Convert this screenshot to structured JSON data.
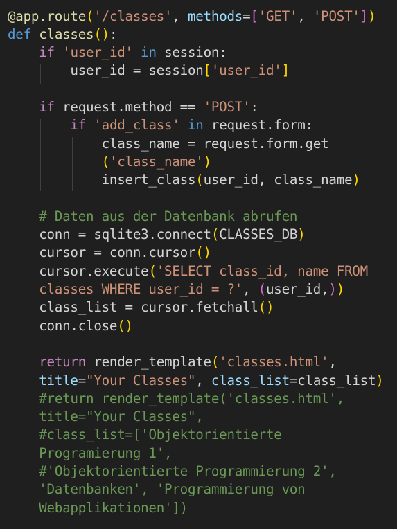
{
  "editor": {
    "language": "python",
    "colors": {
      "background": "#1f1f1f",
      "plain": "#d4d4d4",
      "keyword": "#569cd6",
      "control": "#c586c0",
      "string": "#ce9178",
      "variable": "#9cdcfe",
      "function": "#dcdcaa",
      "comment": "#6a9955",
      "bracket1": "#ffd700",
      "bracket2": "#da70d6",
      "bracket3": "#179fff"
    },
    "lines": [
      {
        "tokens": [
          [
            "fn",
            "@app.route"
          ],
          [
            "br1",
            "("
          ],
          [
            "str",
            "'/classes'"
          ],
          [
            "plain",
            ", "
          ],
          [
            "var",
            "methods"
          ],
          [
            "plain",
            "="
          ],
          [
            "br2",
            "["
          ],
          [
            "str",
            "'GET'"
          ],
          [
            "plain",
            ", "
          ],
          [
            "str",
            "'POST'"
          ],
          [
            "br2",
            "]"
          ],
          [
            "br1",
            ")"
          ]
        ]
      },
      {
        "tokens": [
          [
            "kw",
            "def"
          ],
          [
            "plain",
            " "
          ],
          [
            "fn",
            "classes"
          ],
          [
            "br1",
            "()"
          ],
          [
            "plain",
            ":"
          ]
        ]
      },
      {
        "tokens": [
          [
            "plain",
            "    "
          ],
          [
            "ctl",
            "if"
          ],
          [
            "plain",
            " "
          ],
          [
            "str",
            "'user_id'"
          ],
          [
            "plain",
            " "
          ],
          [
            "kw",
            "in"
          ],
          [
            "plain",
            " session:"
          ]
        ]
      },
      {
        "tokens": [
          [
            "plain",
            "        user_id = session"
          ],
          [
            "br1",
            "["
          ],
          [
            "str",
            "'user_id'"
          ],
          [
            "br1",
            "]"
          ]
        ]
      },
      {
        "tokens": []
      },
      {
        "tokens": [
          [
            "plain",
            "    "
          ],
          [
            "ctl",
            "if"
          ],
          [
            "plain",
            " request.method == "
          ],
          [
            "str",
            "'POST'"
          ],
          [
            "plain",
            ":"
          ]
        ]
      },
      {
        "tokens": [
          [
            "plain",
            "        "
          ],
          [
            "ctl",
            "if"
          ],
          [
            "plain",
            " "
          ],
          [
            "str",
            "'add_class'"
          ],
          [
            "plain",
            " "
          ],
          [
            "kw",
            "in"
          ],
          [
            "plain",
            " request.form:"
          ]
        ]
      },
      {
        "tokens": [
          [
            "plain",
            "            class_name = request.form.get"
          ]
        ]
      },
      {
        "tokens": [
          [
            "plain",
            "            "
          ],
          [
            "br1",
            "("
          ],
          [
            "str",
            "'class_name'"
          ],
          [
            "br1",
            ")"
          ]
        ]
      },
      {
        "tokens": [
          [
            "plain",
            "            insert_class"
          ],
          [
            "br1",
            "("
          ],
          [
            "plain",
            "user_id, class_name"
          ],
          [
            "br1",
            ")"
          ]
        ]
      },
      {
        "tokens": []
      },
      {
        "tokens": [
          [
            "plain",
            "    "
          ],
          [
            "com",
            "# Daten aus der Datenbank abrufen"
          ]
        ]
      },
      {
        "tokens": [
          [
            "plain",
            "    conn = sqlite3.connect"
          ],
          [
            "br1",
            "("
          ],
          [
            "plain",
            "CLASSES_DB"
          ],
          [
            "br1",
            ")"
          ]
        ]
      },
      {
        "tokens": [
          [
            "plain",
            "    cursor = conn.cursor"
          ],
          [
            "br1",
            "()"
          ]
        ]
      },
      {
        "tokens": [
          [
            "plain",
            "    cursor.execute"
          ],
          [
            "br1",
            "("
          ],
          [
            "str",
            "'SELECT class_id, name FROM"
          ]
        ]
      },
      {
        "tokens": [
          [
            "str",
            "    classes WHERE user_id = ?'"
          ],
          [
            "plain",
            ", "
          ],
          [
            "br2",
            "("
          ],
          [
            "plain",
            "user_id,"
          ],
          [
            "br2",
            ")"
          ],
          [
            "br1",
            ")"
          ]
        ]
      },
      {
        "tokens": [
          [
            "plain",
            "    class_list = cursor.fetchall"
          ],
          [
            "br1",
            "()"
          ]
        ]
      },
      {
        "tokens": [
          [
            "plain",
            "    conn.close"
          ],
          [
            "br1",
            "()"
          ]
        ]
      },
      {
        "tokens": []
      },
      {
        "tokens": [
          [
            "plain",
            "    "
          ],
          [
            "ctl",
            "return"
          ],
          [
            "plain",
            " render_template"
          ],
          [
            "br1",
            "("
          ],
          [
            "str",
            "'classes.html'"
          ],
          [
            "plain",
            ","
          ]
        ]
      },
      {
        "tokens": [
          [
            "plain",
            "    "
          ],
          [
            "var",
            "title"
          ],
          [
            "plain",
            "="
          ],
          [
            "str",
            "\"Your Classes\""
          ],
          [
            "plain",
            ", "
          ],
          [
            "var",
            "class_list"
          ],
          [
            "plain",
            "=class_list"
          ],
          [
            "br1",
            ")"
          ]
        ]
      },
      {
        "tokens": [
          [
            "plain",
            "    "
          ],
          [
            "com",
            "#return render_template('classes.html',"
          ]
        ]
      },
      {
        "tokens": [
          [
            "com",
            "    title=\"Your Classes\","
          ]
        ]
      },
      {
        "tokens": [
          [
            "plain",
            "    "
          ],
          [
            "com",
            "#class_list=['Objektorientierte"
          ]
        ]
      },
      {
        "tokens": [
          [
            "com",
            "    Programierung 1',"
          ]
        ]
      },
      {
        "tokens": [
          [
            "plain",
            "    "
          ],
          [
            "com",
            "#'Objektorientierte Programmierung 2',"
          ]
        ]
      },
      {
        "tokens": [
          [
            "com",
            "    'Datenbanken', 'Programmierung von"
          ]
        ]
      },
      {
        "tokens": [
          [
            "com",
            "    Webapplikationen'])"
          ]
        ]
      }
    ]
  }
}
